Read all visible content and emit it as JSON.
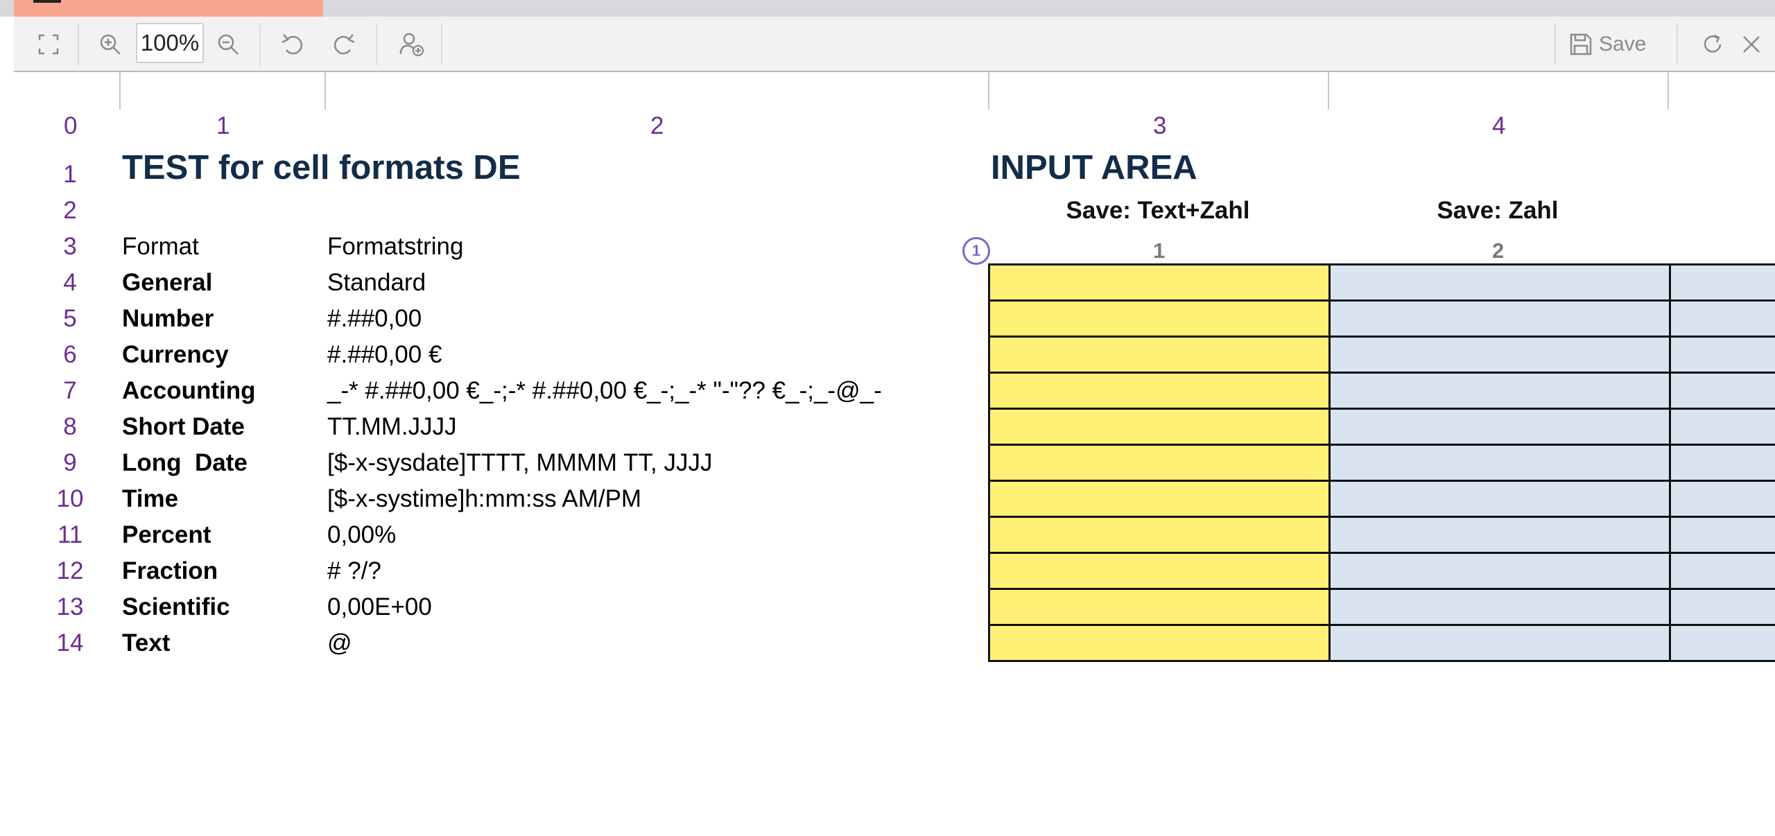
{
  "toolbar": {
    "zoom_value": "100%",
    "save_label": "Save"
  },
  "column_headers": [
    "0",
    "1",
    "2",
    "3",
    "4"
  ],
  "row_numbers": [
    "1",
    "2",
    "3",
    "4",
    "5",
    "6",
    "7",
    "8",
    "9",
    "10",
    "11",
    "12",
    "13",
    "14"
  ],
  "sheet": {
    "title": "TEST for cell formats DE",
    "input_title": "INPUT AREA",
    "header_format": "Format",
    "header_formatstring": "Formatstring",
    "rows": [
      {
        "format": "General",
        "formatstring": "Standard"
      },
      {
        "format": "Number",
        "formatstring": "#.##0,00"
      },
      {
        "format": "Currency",
        "formatstring": "#.##0,00 €"
      },
      {
        "format": "Accounting",
        "formatstring": "_-* #.##0,00 €_-;-* #.##0,00 €_-;_-* \"-\"?? €_-;_-@_-"
      },
      {
        "format": "Short Date",
        "formatstring": "TT.MM.JJJJ"
      },
      {
        "format": "Long  Date",
        "formatstring": "[$-x-sysdate]TTTT, MMMM TT, JJJJ"
      },
      {
        "format": "Time",
        "formatstring": "[$-x-systime]h:mm:ss AM/PM"
      },
      {
        "format": "Percent",
        "formatstring": "0,00%"
      },
      {
        "format": "Fraction",
        "formatstring": "# ?/?"
      },
      {
        "format": "Scientific",
        "formatstring": "0,00E+00"
      },
      {
        "format": "Text",
        "formatstring": "@"
      }
    ],
    "save_text_zahl": "Save: Text+Zahl",
    "save_zahl": "Save: Zahl",
    "input_col_1": "1",
    "input_col_2": "2",
    "group_badge": "1"
  },
  "colors": {
    "input_yellow": "#fff176",
    "input_blue": "#d9e4f0",
    "row_col_number": "#6b2d91",
    "title": "#132c47",
    "active_tab": "#f8a58d"
  }
}
